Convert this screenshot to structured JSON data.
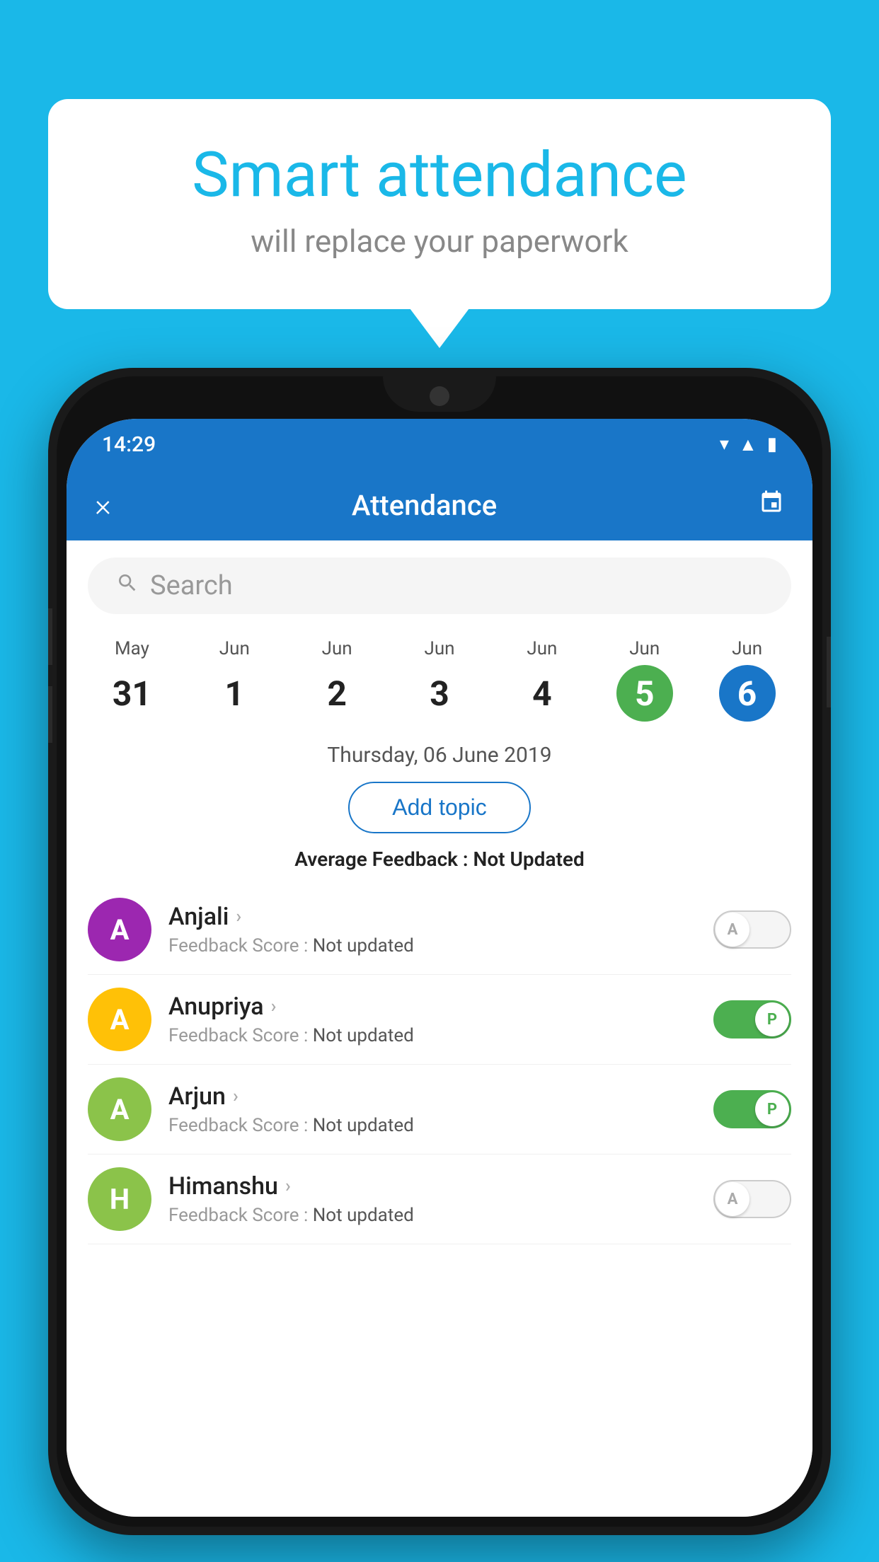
{
  "background_color": "#1ab8e8",
  "speech_bubble": {
    "title": "Smart attendance",
    "subtitle": "will replace your paperwork"
  },
  "status_bar": {
    "time": "14:29",
    "icons": [
      "wifi",
      "signal",
      "battery"
    ]
  },
  "app_header": {
    "title": "Attendance",
    "close_label": "×",
    "calendar_label": "📅"
  },
  "search": {
    "placeholder": "Search"
  },
  "calendar": {
    "days": [
      {
        "month": "May",
        "date": "31",
        "style": "normal"
      },
      {
        "month": "Jun",
        "date": "1",
        "style": "normal"
      },
      {
        "month": "Jun",
        "date": "2",
        "style": "normal"
      },
      {
        "month": "Jun",
        "date": "3",
        "style": "normal"
      },
      {
        "month": "Jun",
        "date": "4",
        "style": "normal"
      },
      {
        "month": "Jun",
        "date": "5",
        "style": "today"
      },
      {
        "month": "Jun",
        "date": "6",
        "style": "selected"
      }
    ]
  },
  "selected_date": "Thursday, 06 June 2019",
  "add_topic_label": "Add topic",
  "average_feedback": {
    "label": "Average Feedback : ",
    "value": "Not Updated"
  },
  "students": [
    {
      "name": "Anjali",
      "avatar_letter": "A",
      "avatar_color": "#9c27b0",
      "feedback": "Feedback Score : Not updated",
      "attendance": "A",
      "toggle_state": "off"
    },
    {
      "name": "Anupriya",
      "avatar_letter": "A",
      "avatar_color": "#ffc107",
      "feedback": "Feedback Score : Not updated",
      "attendance": "P",
      "toggle_state": "on"
    },
    {
      "name": "Arjun",
      "avatar_letter": "A",
      "avatar_color": "#8bc34a",
      "feedback": "Feedback Score : Not updated",
      "attendance": "P",
      "toggle_state": "on"
    },
    {
      "name": "Himanshu",
      "avatar_letter": "H",
      "avatar_color": "#8bc34a",
      "feedback": "Feedback Score : Not updated",
      "attendance": "A",
      "toggle_state": "off"
    }
  ]
}
